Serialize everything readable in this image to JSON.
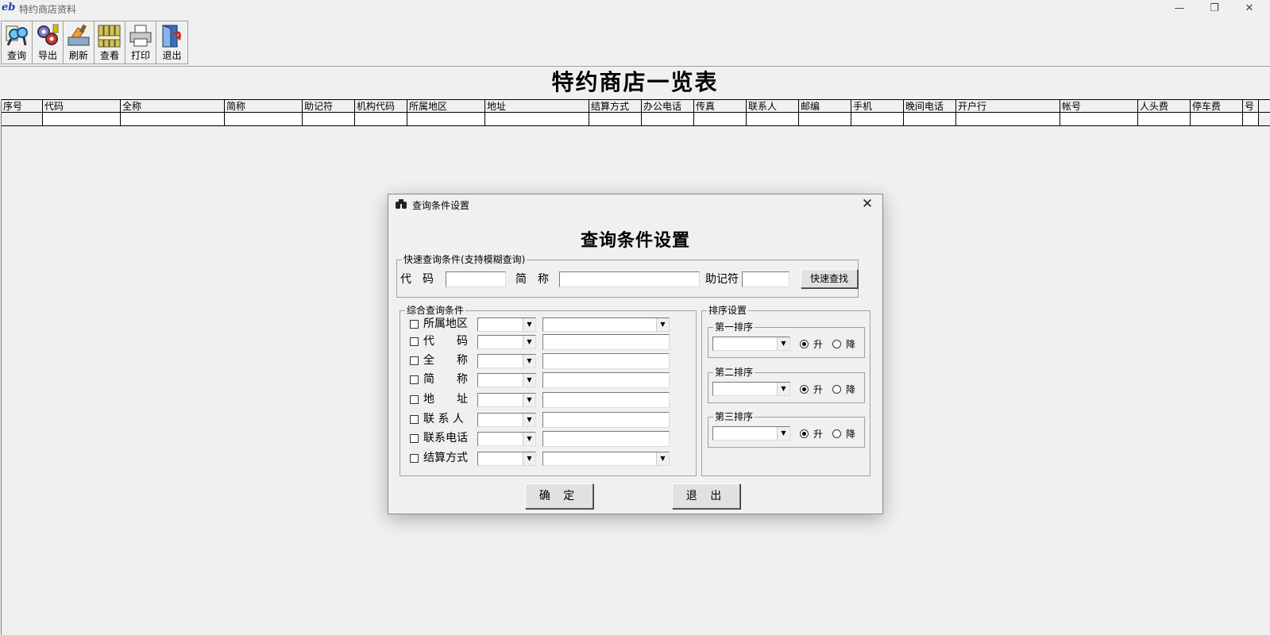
{
  "window": {
    "logo": "eb",
    "title": "特约商店资料",
    "minimize": "—",
    "restore": "❐",
    "close": "✕"
  },
  "toolbar": [
    {
      "label": "查询",
      "icon": "search-binoculars-icon"
    },
    {
      "label": "导出",
      "icon": "export-gears-icon"
    },
    {
      "label": "刷新",
      "icon": "refresh-brush-icon"
    },
    {
      "label": "查看",
      "icon": "view-binders-icon"
    },
    {
      "label": "打印",
      "icon": "printer-icon"
    },
    {
      "label": "退出",
      "icon": "exit-door-icon"
    }
  ],
  "report": {
    "title": "特约商店一览表",
    "columns": [
      "序号",
      "代码",
      "全称",
      "简称",
      "助记符",
      "机构代码",
      "所属地区",
      "地址",
      "结算方式",
      "办公电话",
      "传真",
      "联系人",
      "邮编",
      "手机",
      "晚间电话",
      "开户行",
      "帐号",
      "人头费",
      "停车费",
      "号"
    ]
  },
  "dialog": {
    "title": "查询条件设置",
    "heading": "查询条件设置",
    "close": "✕",
    "quick": {
      "legend": "快速查询条件(支持模糊查询)",
      "code_label": "代　码",
      "short_label": "简　称",
      "mnemonic_label": "助记符",
      "code_value": "",
      "short_value": "",
      "mnemonic_value": "",
      "search_button": "快速查找"
    },
    "combined": {
      "legend": "综合查询条件",
      "rows": [
        {
          "label": "所属地区",
          "checked": false,
          "value_type": "combo"
        },
        {
          "label": "代　　码",
          "checked": false,
          "value_type": "text"
        },
        {
          "label": "全　　称",
          "checked": false,
          "value_type": "text"
        },
        {
          "label": "简　　称",
          "checked": false,
          "value_type": "text"
        },
        {
          "label": "地　　址",
          "checked": false,
          "value_type": "text"
        },
        {
          "label": "联 系 人",
          "checked": false,
          "value_type": "text"
        },
        {
          "label": "联系电话",
          "checked": false,
          "value_type": "text"
        },
        {
          "label": "结算方式",
          "checked": false,
          "value_type": "combo"
        }
      ]
    },
    "sort": {
      "legend": "排序设置",
      "groups": [
        {
          "legend": "第一排序",
          "asc": "升",
          "desc": "降",
          "selected": "asc"
        },
        {
          "legend": "第二排序",
          "asc": "升",
          "desc": "降",
          "selected": "asc"
        },
        {
          "legend": "第三排序",
          "asc": "升",
          "desc": "降",
          "selected": "asc"
        }
      ]
    },
    "ok_button": "确 定",
    "exit_button": "退 出"
  }
}
